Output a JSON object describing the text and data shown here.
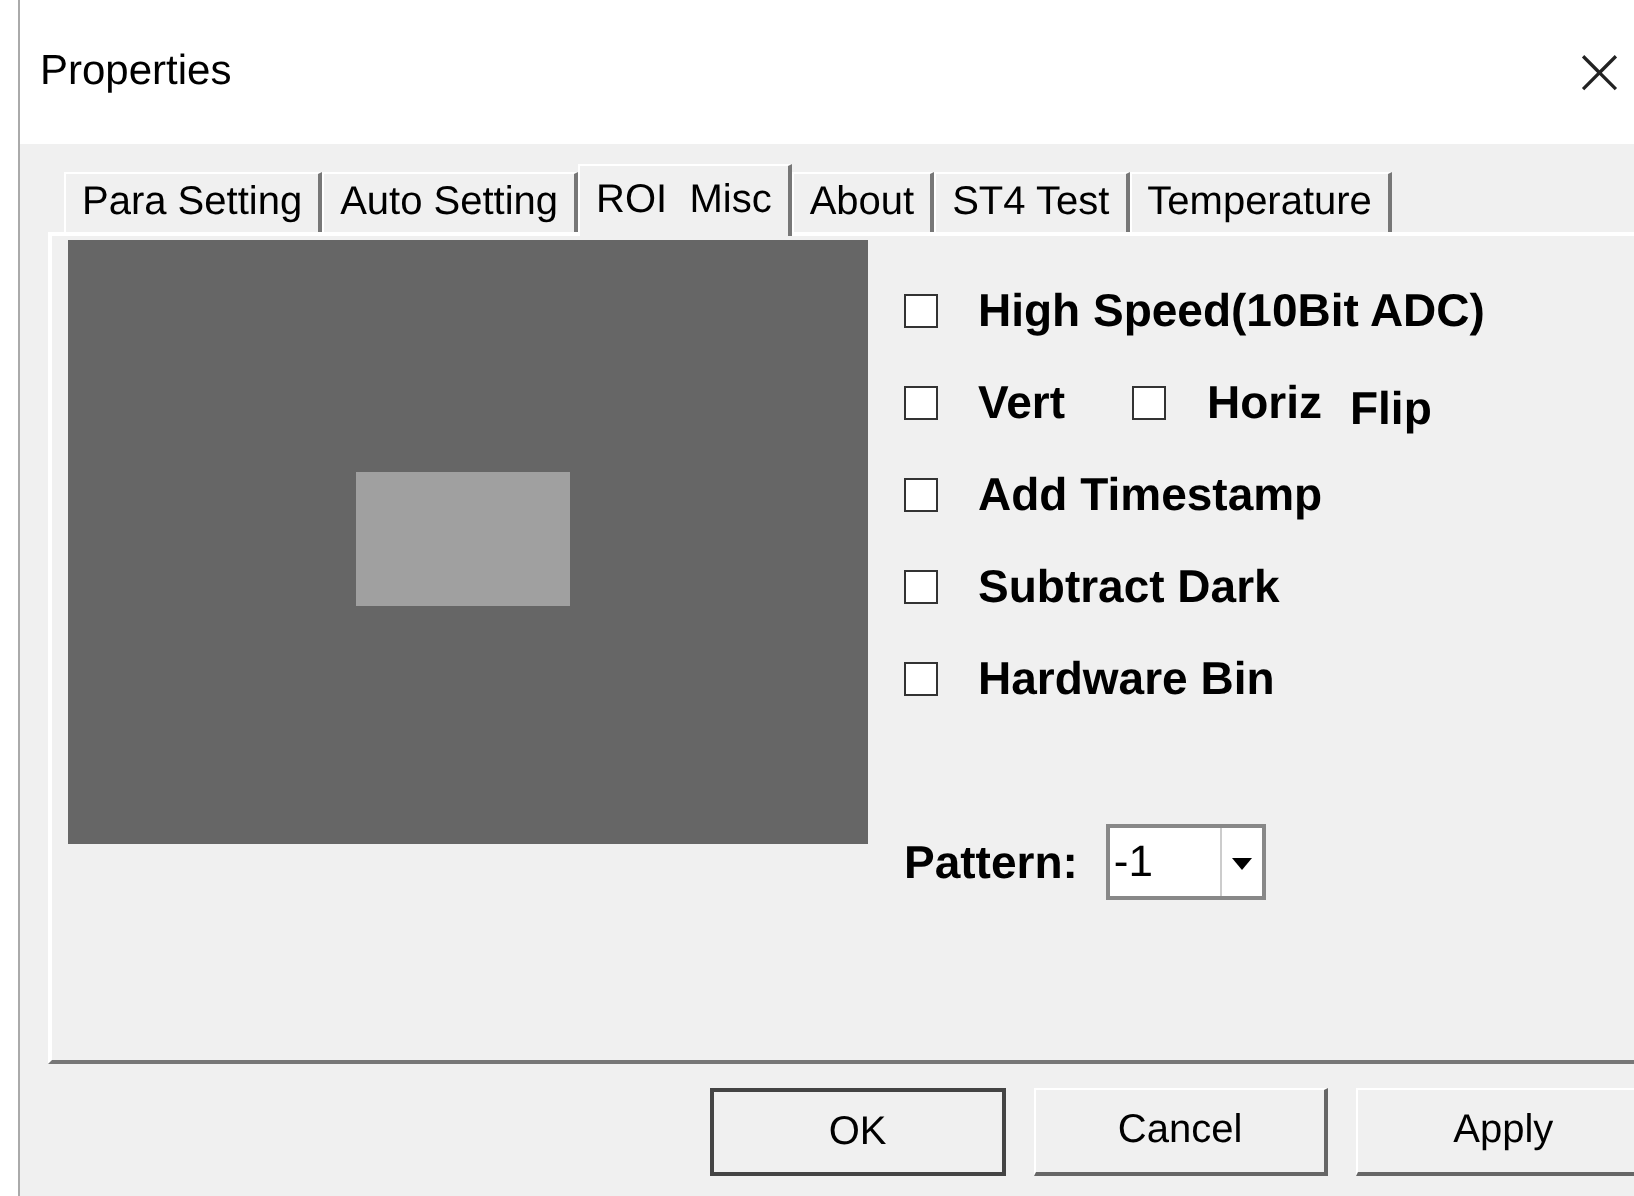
{
  "window": {
    "title": "Properties",
    "close": "×"
  },
  "tabs": [
    {
      "label": "Para Setting",
      "selected": false
    },
    {
      "label": "Auto Setting",
      "selected": false
    },
    {
      "label": "ROI  Misc",
      "selected": true
    },
    {
      "label": "About",
      "selected": false
    },
    {
      "label": "ST4 Test",
      "selected": false
    },
    {
      "label": "Temperature",
      "selected": false
    }
  ],
  "options": [
    {
      "kind": "single",
      "label": "High Speed(10Bit ADC)",
      "checked": false
    },
    {
      "kind": "pair",
      "items": [
        {
          "label": "Vert",
          "checked": false
        },
        {
          "label": "Horiz",
          "checked": false
        }
      ],
      "suffix": "Flip"
    },
    {
      "kind": "single",
      "label": "Add Timestamp",
      "checked": false
    },
    {
      "kind": "single",
      "label": "Subtract Dark",
      "checked": false
    },
    {
      "kind": "single",
      "label": "Hardware Bin",
      "checked": false
    }
  ],
  "pattern": {
    "label": "Pattern:",
    "value": "-1"
  },
  "buttons": [
    {
      "label": "OK",
      "default": true
    },
    {
      "label": "Cancel",
      "default": false
    },
    {
      "label": "Apply",
      "default": false
    }
  ]
}
